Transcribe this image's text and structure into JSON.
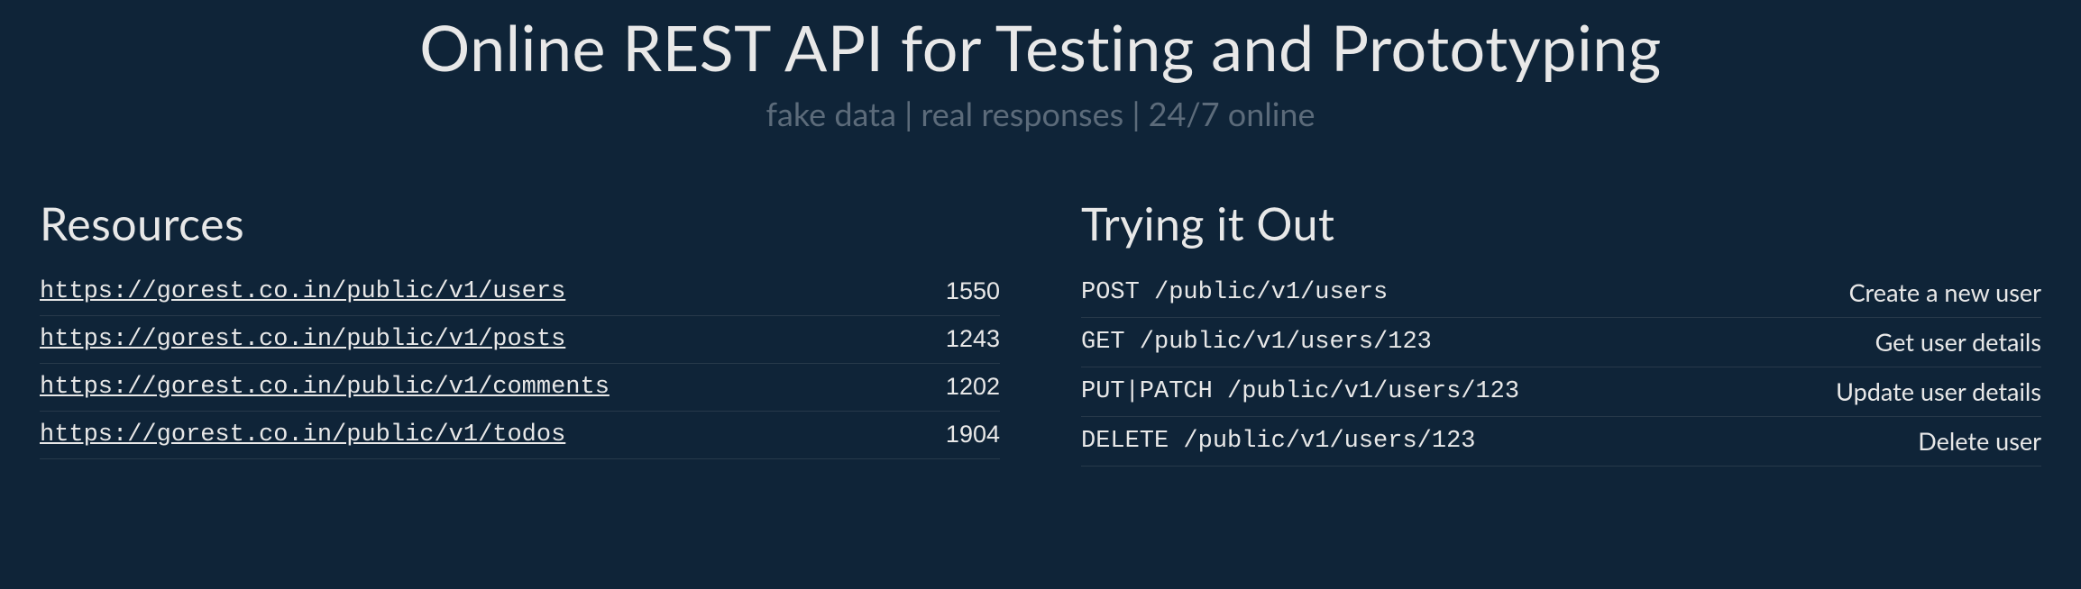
{
  "hero": {
    "title": "Online REST API for Testing and Prototyping",
    "subtitle": "fake data | real responses | 24/7 online"
  },
  "resources": {
    "heading": "Resources",
    "items": [
      {
        "url": "https://gorest.co.in/public/v1/users",
        "count": "1550"
      },
      {
        "url": "https://gorest.co.in/public/v1/posts",
        "count": "1243"
      },
      {
        "url": "https://gorest.co.in/public/v1/comments",
        "count": "1202"
      },
      {
        "url": "https://gorest.co.in/public/v1/todos",
        "count": "1904"
      }
    ]
  },
  "trying": {
    "heading": "Trying it Out",
    "items": [
      {
        "endpoint": "POST /public/v1/users",
        "desc": "Create a new user"
      },
      {
        "endpoint": "GET /public/v1/users/123",
        "desc": "Get user details"
      },
      {
        "endpoint": "PUT|PATCH /public/v1/users/123",
        "desc": "Update user details"
      },
      {
        "endpoint": "DELETE /public/v1/users/123",
        "desc": "Delete user"
      }
    ]
  }
}
